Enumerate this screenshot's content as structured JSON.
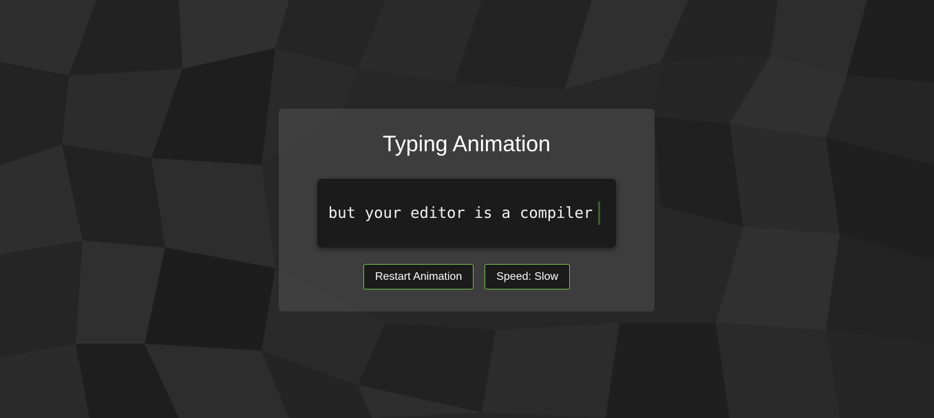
{
  "card": {
    "title": "Typing Animation"
  },
  "terminal": {
    "text": "but your editor is a compiler"
  },
  "buttons": {
    "restart_label": "Restart Animation",
    "speed_label": "Speed: Slow"
  },
  "colors": {
    "accent": "#76c14f",
    "background": "#262626",
    "terminal": "#1b1b1b"
  },
  "icons": [
    "cursor-icon"
  ]
}
